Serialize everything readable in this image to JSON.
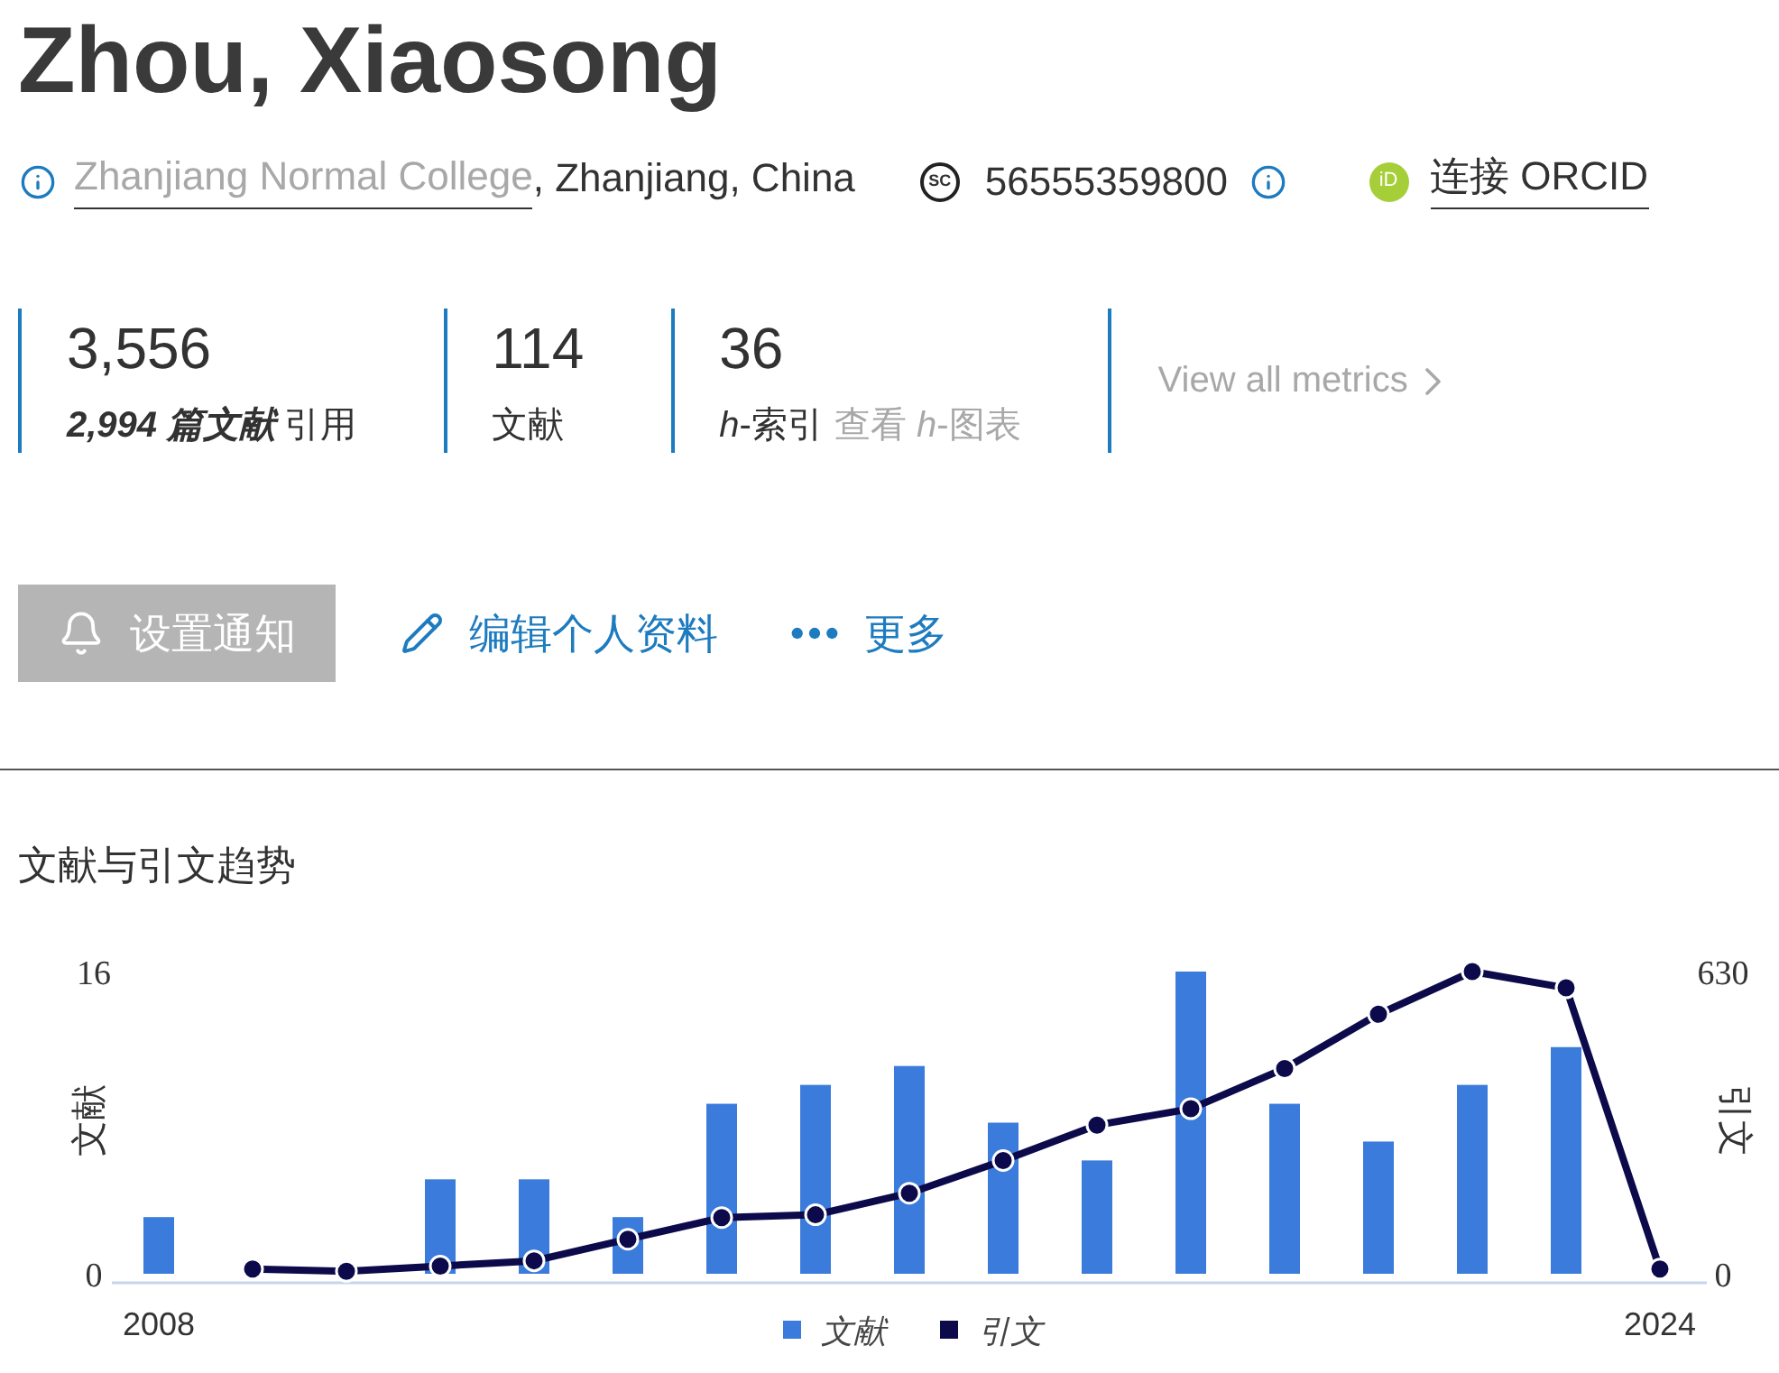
{
  "profile": {
    "name": "Zhou, Xiaosong"
  },
  "affiliation": {
    "institution": "Zhanjiang Normal College",
    "location": ", Zhanjiang, China"
  },
  "author_id": {
    "badge": "SC",
    "value": "56555359800"
  },
  "orcid": {
    "badge": "iD",
    "label": "连接 ORCID"
  },
  "metrics": [
    {
      "value": "3,556",
      "label_strong": "2,994 篇文献",
      "label": "引用"
    },
    {
      "value": "114",
      "label": "文献"
    },
    {
      "value": "36",
      "label": "*h*-索引",
      "link": "查看 *h*-图表"
    }
  ],
  "view_all_metrics": "View all metrics",
  "actions": [
    {
      "kind": "alert",
      "label": "设置通知"
    },
    {
      "kind": "edit",
      "label": "编辑个人资料"
    },
    {
      "kind": "more",
      "label": "更多"
    }
  ],
  "trends": {
    "title": "文献与引文趋势",
    "chart_data": {
      "type": "bar",
      "ylabel": "文献",
      "y2label": "引文",
      "x": [
        2008,
        2009,
        2010,
        2011,
        2012,
        2013,
        2014,
        2015,
        2016,
        2017,
        2018,
        2019,
        2020,
        2021,
        2022,
        2023,
        2024
      ],
      "xlim": [
        2007.5,
        2024.5
      ],
      "xticks": [
        2008,
        2024
      ],
      "ylim": [
        0,
        16
      ],
      "yticks": [
        0,
        16
      ],
      "y2lim": [
        0,
        630
      ],
      "y2ticks": [
        0,
        630
      ],
      "legend": "bottom",
      "series": [
        {
          "name": "文献",
          "color": "#3a7bdb",
          "type": "bar",
          "values": [
            3,
            0,
            0,
            5,
            5,
            3,
            9,
            10,
            11,
            8,
            6,
            16,
            9,
            7,
            10,
            12,
            0
          ]
        },
        {
          "name": "引文",
          "color": "#0c0a4a",
          "type": "line",
          "axis": "y2",
          "marker": "circle",
          "values": [
            null,
            10,
            5,
            16,
            27,
            72,
            117,
            123,
            168,
            236,
            310,
            344,
            428,
            541,
            630,
            596,
            10
          ]
        }
      ]
    }
  }
}
